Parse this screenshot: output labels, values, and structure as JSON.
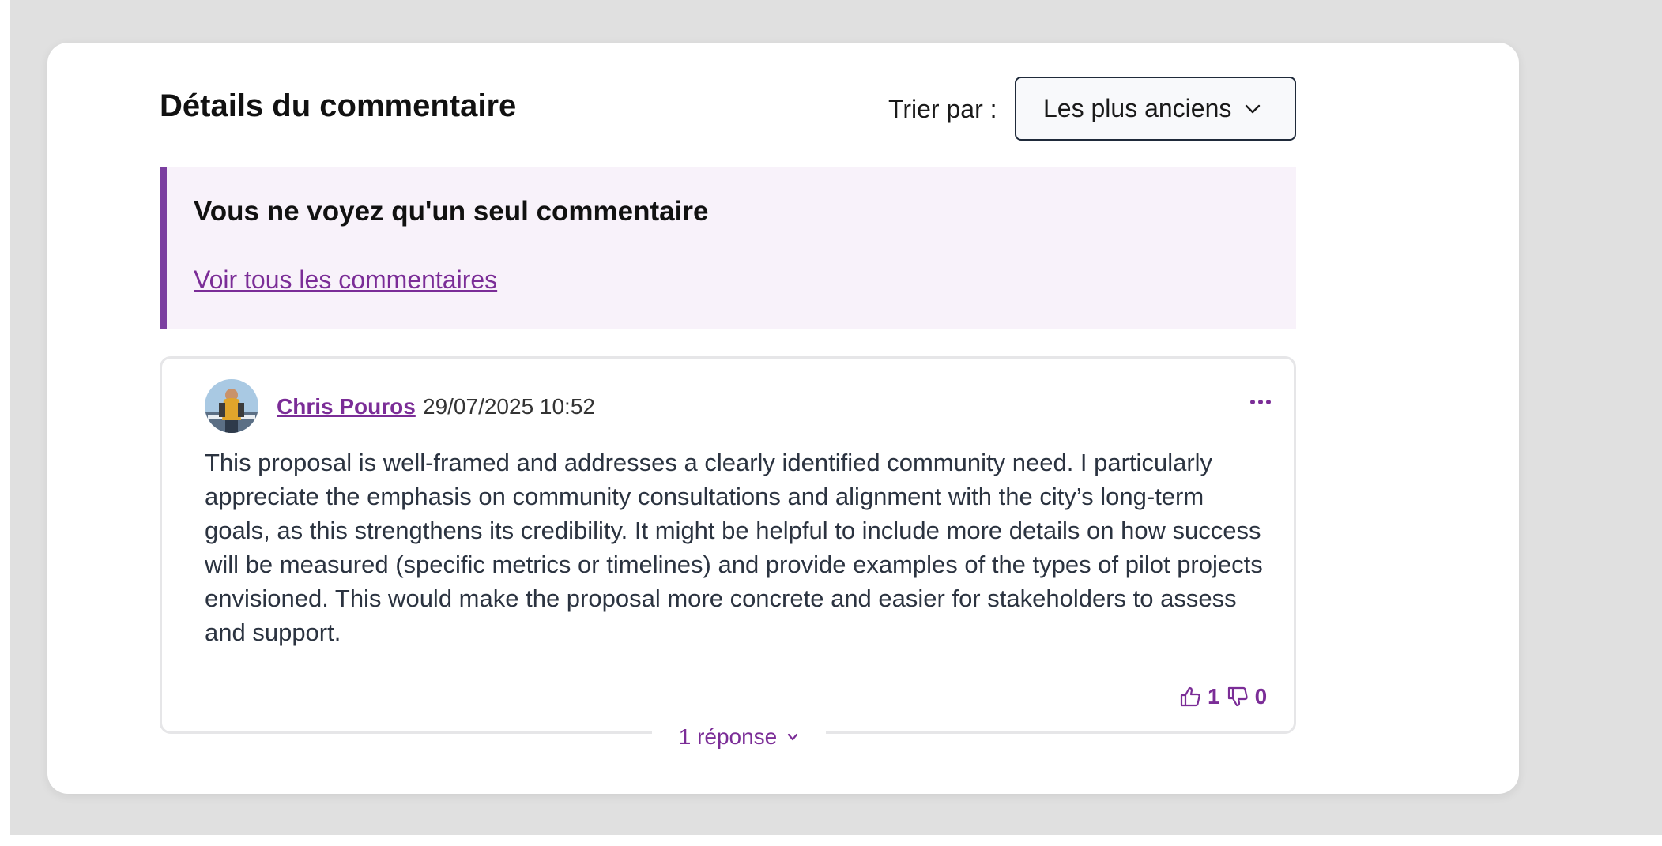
{
  "panel": {
    "title": "Détails du commentaire",
    "sort": {
      "label": "Trier par :",
      "selected": "Les plus anciens",
      "chevron_icon": "chevron-down-icon"
    }
  },
  "notice": {
    "heading": "Vous ne voyez qu'un seul commentaire",
    "link": "Voir tous les commentaires"
  },
  "comment": {
    "author": "Chris Pouros",
    "timestamp": "29/07/2025 10:52",
    "more_icon": "more-icon",
    "body": "This proposal is well-framed and addresses a clearly identified community need. I particularly appreciate the emphasis on community consultations and alignment with the city’s long-term goals, as this strengthens its credibility. It might be helpful to include more details on how success will be measured (specific metrics or timelines) and provide examples of the types of pilot projects envisioned. This would make the proposal more concrete and easier for stakeholders to assess and support.",
    "upvotes": "1",
    "downvotes": "0",
    "replies_label": "1 réponse"
  },
  "colors": {
    "accent": "#7b2d97",
    "notice_bg": "#f8f2fa",
    "notice_border": "#7b3fa0",
    "page_bg": "#e0e0e0"
  }
}
